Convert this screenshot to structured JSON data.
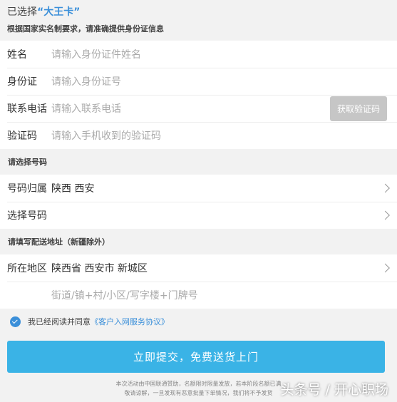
{
  "header": {
    "selected_prefix": "已选择",
    "selected_card": "“大王卡”",
    "notice": "根据国家实名制要求，请准确提供身份证信息"
  },
  "identity": {
    "name_label": "姓名",
    "name_placeholder": "请输入身份证件姓名",
    "id_label": "身份证",
    "id_placeholder": "请输入身份证号",
    "phone_label": "联系电话",
    "phone_placeholder": "请输入联系电话",
    "get_code_button": "获取验证码",
    "code_label": "验证码",
    "code_placeholder": "请输入手机收到的验证码"
  },
  "number_section": {
    "title": "请选择号码",
    "location_label": "号码归属",
    "location_value": "陕西 西安",
    "choose_label": "选择号码"
  },
  "address_section": {
    "title": "请填写配送地址（新疆除外）",
    "region_label": "所在地区",
    "region_value": "陕西省 西安市 新城区",
    "street_placeholder": "街道/镇+村/小区/写字楼+门牌号"
  },
  "agreement": {
    "prefix": "我已经阅读并同意",
    "link": "《客户入网服务协议》"
  },
  "submit_button": "立即提交，免费送货上门",
  "footnote": {
    "line1": "本次活动由中国联通赞助，名额限时限量发放，若本阶段名额已满",
    "line2": "敬请谅解，一旦发现有恶意批量下单情况，我们将不予发货"
  },
  "watermark": "头条号 / 开心职场",
  "colors": {
    "accent": "#3a8fd9",
    "submit": "#3ab3e6",
    "disabled_button": "#c6c6c6"
  }
}
